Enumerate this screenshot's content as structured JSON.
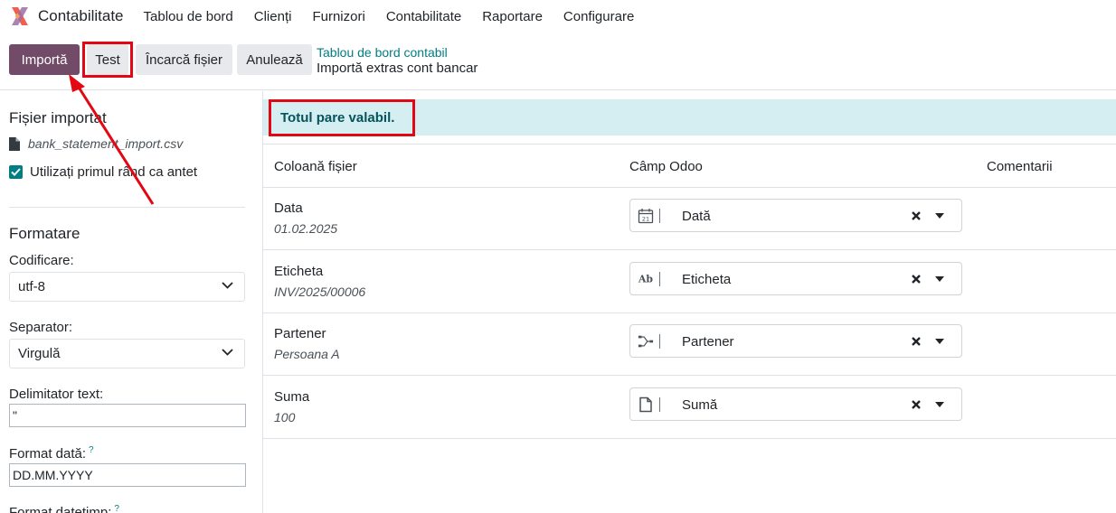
{
  "navbar": {
    "app_name": "Contabilitate",
    "menu": [
      "Tablou de bord",
      "Clienți",
      "Furnizori",
      "Contabilitate",
      "Raportare",
      "Configurare"
    ]
  },
  "toolbar": {
    "import_label": "Importă",
    "test_label": "Test",
    "upload_label": "Încarcă fișier",
    "cancel_label": "Anulează"
  },
  "breadcrumb": {
    "parent": "Tablou de bord contabil",
    "current": "Importă extras cont bancar"
  },
  "sidebar": {
    "imported_file_title": "Fișier importat",
    "file_name": "bank_statement_import.csv",
    "header_checkbox_label": "Utilizați primul rând ca antet",
    "header_checkbox_checked": true,
    "formatting_title": "Formatare",
    "encoding_label": "Codificare:",
    "encoding_value": "utf-8",
    "separator_label": "Separator:",
    "separator_value": "Virgulă",
    "text_delimiter_label": "Delimitator text:",
    "text_delimiter_value": "\"",
    "date_format_label": "Format dată:",
    "date_format_value": "DD.MM.YYYY",
    "datetime_format_label": "Format datetimp:",
    "help_mark": "?"
  },
  "main": {
    "alert": "Totul pare valabil.",
    "headers": {
      "file_column": "Coloană fișier",
      "odoo_field": "Câmp Odoo",
      "comments": "Comentarii"
    },
    "rows": [
      {
        "column": "Data",
        "sample": "01.02.2025",
        "field": "Dată",
        "icon": "calendar-icon"
      },
      {
        "column": "Eticheta",
        "sample": "INV/2025/00006",
        "field": "Eticheta",
        "icon": "text-field-icon"
      },
      {
        "column": "Partener",
        "sample": "Persoana A",
        "field": "Partener",
        "icon": "relation-icon"
      },
      {
        "column": "Suma",
        "sample": "100",
        "field": "Sumă",
        "icon": "document-icon"
      }
    ]
  },
  "colors": {
    "primary": "#714b67",
    "accent": "#017e84",
    "alert_bg": "#d4eef2",
    "alert_text": "#05535b",
    "annotation_red": "#e30613"
  }
}
